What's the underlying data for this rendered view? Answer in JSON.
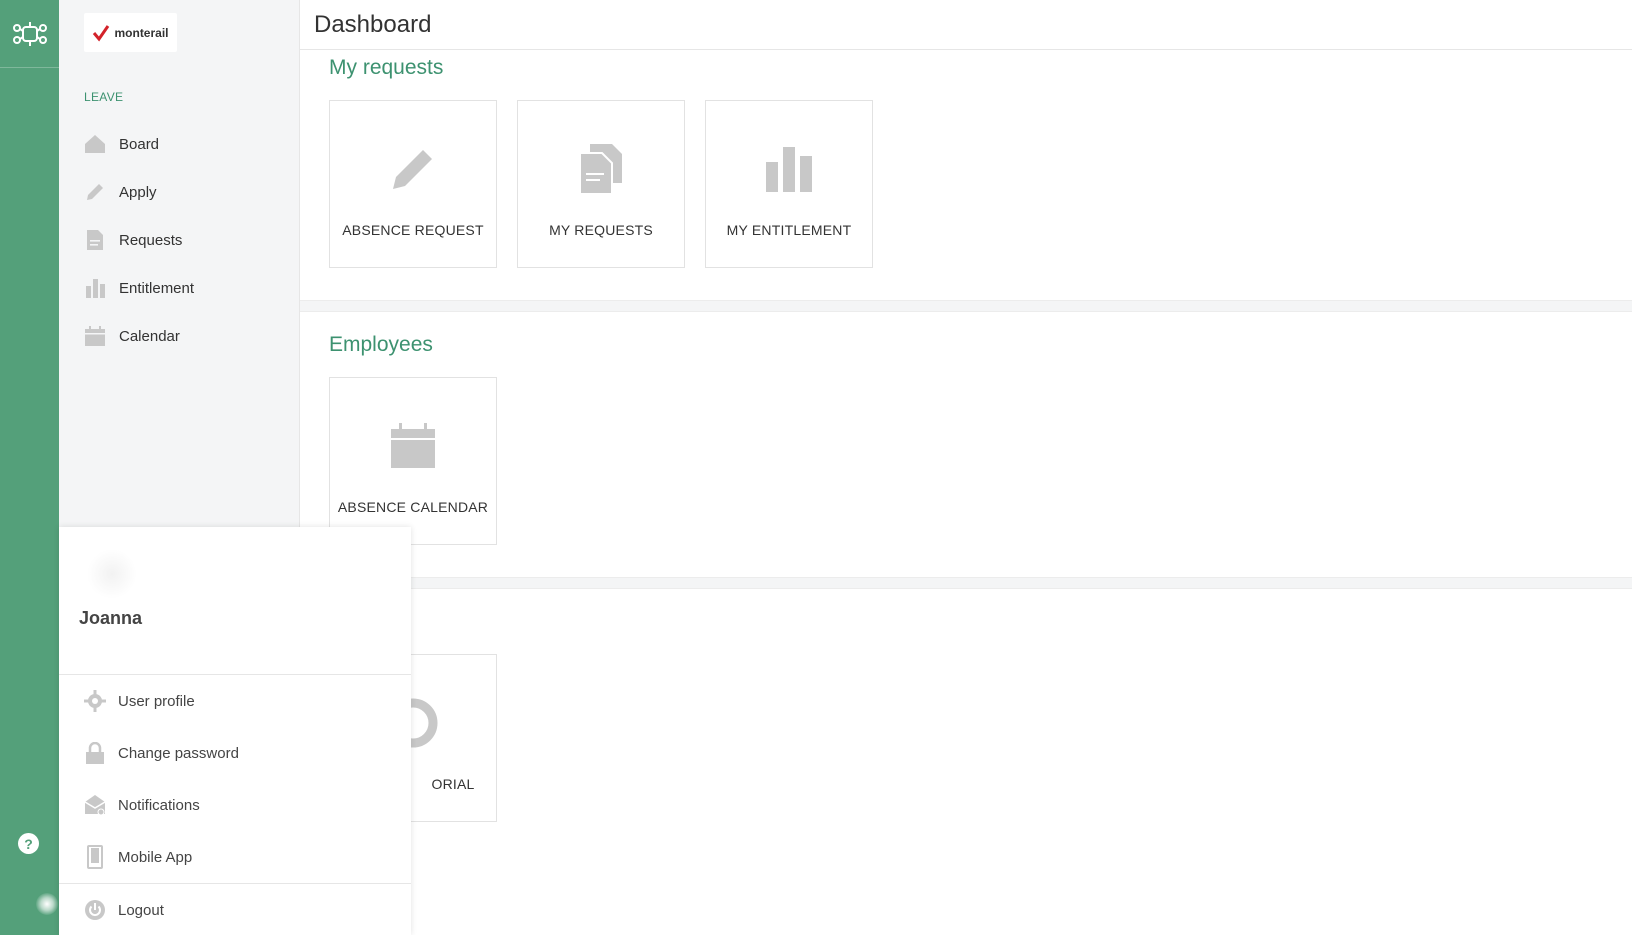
{
  "brand": {
    "logo_text": "monterail"
  },
  "sidebar": {
    "section_label": "LEAVE",
    "items": [
      {
        "label": "Board",
        "icon": "home-icon"
      },
      {
        "label": "Apply",
        "icon": "pencil-icon"
      },
      {
        "label": "Requests",
        "icon": "document-icon"
      },
      {
        "label": "Entitlement",
        "icon": "bar-chart-icon"
      },
      {
        "label": "Calendar",
        "icon": "calendar-icon"
      }
    ]
  },
  "header": {
    "title": "Dashboard"
  },
  "sections": {
    "my_requests": {
      "title": "My requests",
      "cards": [
        {
          "label": "ABSENCE REQUEST",
          "icon": "pencil-icon"
        },
        {
          "label": "MY REQUESTS",
          "icon": "documents-icon"
        },
        {
          "label": "MY ENTITLEMENT",
          "icon": "bar-chart-icon"
        }
      ]
    },
    "employees": {
      "title": "Employees",
      "cards": [
        {
          "label": "ABSENCE CALENDAR",
          "icon": "calendar-icon"
        }
      ]
    },
    "other": {
      "cards": [
        {
          "label": "ORIAL",
          "icon": "lifebuoy-icon"
        }
      ]
    }
  },
  "user_menu": {
    "name": "Joanna",
    "items": [
      {
        "label": "User profile",
        "icon": "gear-icon"
      },
      {
        "label": "Change password",
        "icon": "lock-icon"
      },
      {
        "label": "Notifications",
        "icon": "envelope-icon"
      },
      {
        "label": "Mobile App",
        "icon": "phone-icon"
      }
    ],
    "logout_label": "Logout"
  },
  "rail": {
    "help_label": "?"
  },
  "colors": {
    "accent": "#54a07a",
    "accent_text": "#3d9270",
    "icon_gray": "#c8c8c8"
  }
}
